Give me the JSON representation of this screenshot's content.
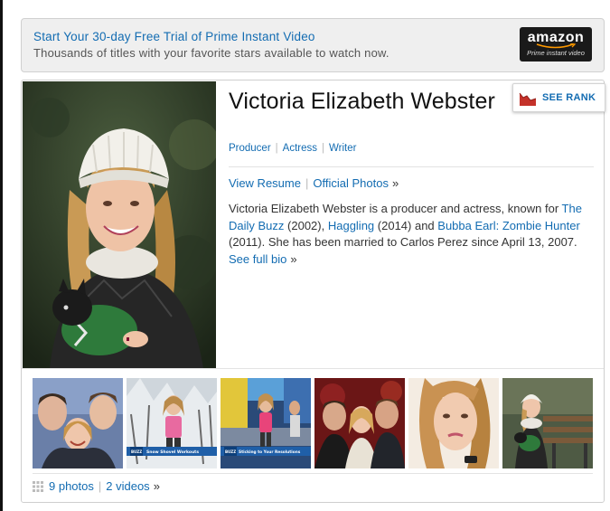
{
  "promo": {
    "title": "Start Your 30-day Free Trial of Prime Instant Video",
    "subtitle": "Thousands of titles with your favorite stars available to watch now.",
    "logo_word": "amazon",
    "logo_sub": "Prime instant video"
  },
  "profile": {
    "name": "Victoria Elizabeth Webster",
    "roles": [
      "Producer",
      "Actress",
      "Writer"
    ],
    "links": {
      "resume": "View Resume",
      "photos": "Official Photos",
      "arrow": "»"
    },
    "bio": {
      "p1": "Victoria Elizabeth Webster is a producer and actress, known for ",
      "film1": "The Daily Buzz",
      "y1": " (2002), ",
      "film2": "Haggling",
      "y2": " (2014) and ",
      "film3": "Bubba Earl: Zombie Hunter",
      "y3": " (2011). She has been married to Carlos Perez since April 13, 2007. ",
      "more": "See full bio",
      "arrow": "»"
    },
    "rank_button": "SEE RANK"
  },
  "thumbnails": [
    {
      "name": "group-selfie",
      "caption": ""
    },
    {
      "name": "snow-shovel-workout",
      "caption": "Snow Shovel Workouts"
    },
    {
      "name": "sticking-to-resolutions",
      "caption": "Sticking to Your Resolutions"
    },
    {
      "name": "group-portrait",
      "caption": ""
    },
    {
      "name": "selfie-closeup",
      "caption": ""
    },
    {
      "name": "bench-with-dog",
      "caption": ""
    }
  ],
  "thumb_badge": "BUZZ",
  "media": {
    "photos": "9 photos",
    "videos": "2 videos",
    "arrow": "»"
  },
  "colors": {
    "link": "#136cb2",
    "rank_red": "#c4322a",
    "promo_bg": "#efefef"
  }
}
